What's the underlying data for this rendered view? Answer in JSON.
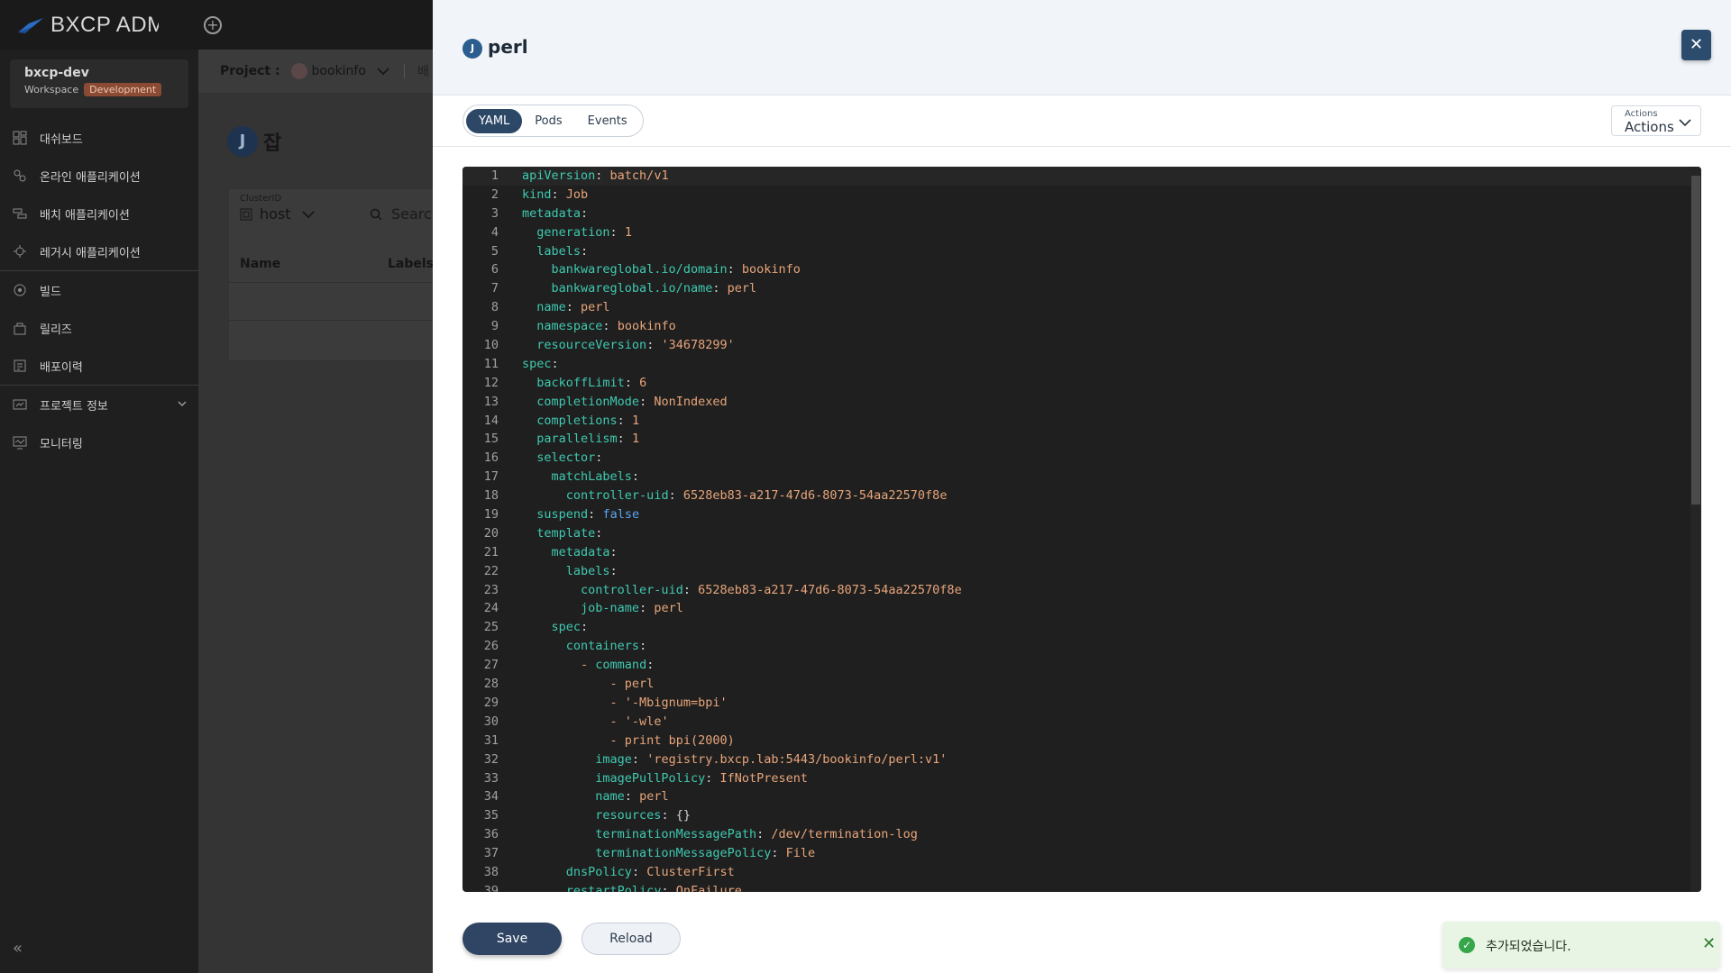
{
  "app": {
    "logo_text": "BXCP ADMIN"
  },
  "workspace": {
    "name": "bxcp-dev",
    "label": "Workspace",
    "badge": "Development"
  },
  "sidebar": {
    "items": [
      {
        "label": "대쉬보드",
        "icon": "dashboard-icon"
      },
      {
        "label": "온라인 애플리케이션",
        "icon": "online-app-icon"
      },
      {
        "label": "배치 애플리케이션",
        "icon": "batch-app-icon"
      },
      {
        "label": "레거시 애플리케이션",
        "icon": "legacy-app-icon"
      },
      {
        "label": "빌드",
        "icon": "build-icon"
      },
      {
        "label": "릴리즈",
        "icon": "release-icon"
      },
      {
        "label": "배포이력",
        "icon": "deploy-history-icon"
      },
      {
        "label": "프로젝트 정보",
        "icon": "project-info-icon"
      },
      {
        "label": "모니터링",
        "icon": "monitoring-icon"
      }
    ],
    "collapse": "«"
  },
  "main": {
    "project_label": "Project :",
    "project_name": "bookinfo",
    "project_extra": "배",
    "page_avatar": "J",
    "page_title": "잡",
    "cluster_label": "ClusterID",
    "cluster_value": "host",
    "search_placeholder": "Search",
    "col_name": "Name",
    "col_labels": "Labels"
  },
  "drawer": {
    "avatar": "J",
    "title": "perl",
    "close": "✕",
    "tabs": [
      {
        "label": "YAML",
        "active": true
      },
      {
        "label": "Pods"
      },
      {
        "label": "Events"
      }
    ],
    "actions_small": "Actions",
    "actions_label": "Actions",
    "save": "Save",
    "reload": "Reload"
  },
  "yaml_lines": [
    [
      [
        0,
        "apiVersion",
        "k"
      ],
      [
        0,
        ": ",
        "p"
      ],
      [
        0,
        "batch/v1",
        "v"
      ]
    ],
    [
      [
        0,
        "kind",
        "k"
      ],
      [
        0,
        ": ",
        "p"
      ],
      [
        0,
        "Job",
        "v"
      ]
    ],
    [
      [
        0,
        "metadata",
        "k"
      ],
      [
        0,
        ":",
        "p"
      ]
    ],
    [
      [
        1,
        "generation",
        "k"
      ],
      [
        0,
        ": ",
        "p"
      ],
      [
        0,
        "1",
        "v"
      ]
    ],
    [
      [
        1,
        "labels",
        "k"
      ],
      [
        0,
        ":",
        "p"
      ]
    ],
    [
      [
        2,
        "bankwareglobal.io/domain",
        "k"
      ],
      [
        0,
        ": ",
        "p"
      ],
      [
        0,
        "bookinfo",
        "v"
      ]
    ],
    [
      [
        2,
        "bankwareglobal.io/name",
        "k"
      ],
      [
        0,
        ": ",
        "p"
      ],
      [
        0,
        "perl",
        "v"
      ]
    ],
    [
      [
        1,
        "name",
        "k"
      ],
      [
        0,
        ": ",
        "p"
      ],
      [
        0,
        "perl",
        "v"
      ]
    ],
    [
      [
        1,
        "namespace",
        "k"
      ],
      [
        0,
        ": ",
        "p"
      ],
      [
        0,
        "bookinfo",
        "v"
      ]
    ],
    [
      [
        1,
        "resourceVersion",
        "k"
      ],
      [
        0,
        ": ",
        "p"
      ],
      [
        0,
        "'34678299'",
        "v"
      ]
    ],
    [
      [
        0,
        "spec",
        "k"
      ],
      [
        0,
        ":",
        "p"
      ]
    ],
    [
      [
        1,
        "backoffLimit",
        "k"
      ],
      [
        0,
        ": ",
        "p"
      ],
      [
        0,
        "6",
        "v"
      ]
    ],
    [
      [
        1,
        "completionMode",
        "k"
      ],
      [
        0,
        ": ",
        "p"
      ],
      [
        0,
        "NonIndexed",
        "v"
      ]
    ],
    [
      [
        1,
        "completions",
        "k"
      ],
      [
        0,
        ": ",
        "p"
      ],
      [
        0,
        "1",
        "v"
      ]
    ],
    [
      [
        1,
        "parallelism",
        "k"
      ],
      [
        0,
        ": ",
        "p"
      ],
      [
        0,
        "1",
        "v"
      ]
    ],
    [
      [
        1,
        "selector",
        "k"
      ],
      [
        0,
        ":",
        "p"
      ]
    ],
    [
      [
        2,
        "matchLabels",
        "k"
      ],
      [
        0,
        ":",
        "p"
      ]
    ],
    [
      [
        3,
        "controller-uid",
        "k"
      ],
      [
        0,
        ": ",
        "p"
      ],
      [
        0,
        "6528eb83-a217-47d6-8073-54aa22570f8e",
        "v"
      ]
    ],
    [
      [
        1,
        "suspend",
        "k"
      ],
      [
        0,
        ": ",
        "p"
      ],
      [
        0,
        "false",
        "b"
      ]
    ],
    [
      [
        1,
        "template",
        "k"
      ],
      [
        0,
        ":",
        "p"
      ]
    ],
    [
      [
        2,
        "metadata",
        "k"
      ],
      [
        0,
        ":",
        "p"
      ]
    ],
    [
      [
        3,
        "labels",
        "k"
      ],
      [
        0,
        ":",
        "p"
      ]
    ],
    [
      [
        4,
        "controller-uid",
        "k"
      ],
      [
        0,
        ": ",
        "p"
      ],
      [
        0,
        "6528eb83-a217-47d6-8073-54aa22570f8e",
        "v"
      ]
    ],
    [
      [
        4,
        "job-name",
        "k"
      ],
      [
        0,
        ": ",
        "p"
      ],
      [
        0,
        "perl",
        "v"
      ]
    ],
    [
      [
        2,
        "spec",
        "k"
      ],
      [
        0,
        ":",
        "p"
      ]
    ],
    [
      [
        3,
        "containers",
        "k"
      ],
      [
        0,
        ":",
        "p"
      ]
    ],
    [
      [
        4,
        "- ",
        "v"
      ],
      [
        0,
        "command",
        "k"
      ],
      [
        0,
        ":",
        "p"
      ]
    ],
    [
      [
        6,
        "- perl",
        "v"
      ]
    ],
    [
      [
        6,
        "- '-Mbignum=bpi'",
        "v"
      ]
    ],
    [
      [
        6,
        "- '-wle'",
        "v"
      ]
    ],
    [
      [
        6,
        "- print bpi(2000)",
        "v"
      ]
    ],
    [
      [
        5,
        "image",
        "k"
      ],
      [
        0,
        ": ",
        "p"
      ],
      [
        0,
        "'registry.bxcp.lab:5443/bookinfo/perl:v1'",
        "v"
      ]
    ],
    [
      [
        5,
        "imagePullPolicy",
        "k"
      ],
      [
        0,
        ": ",
        "p"
      ],
      [
        0,
        "IfNotPresent",
        "v"
      ]
    ],
    [
      [
        5,
        "name",
        "k"
      ],
      [
        0,
        ": ",
        "p"
      ],
      [
        0,
        "perl",
        "v"
      ]
    ],
    [
      [
        5,
        "resources",
        "k"
      ],
      [
        0,
        ": ",
        "p"
      ],
      [
        0,
        "{}",
        "p"
      ]
    ],
    [
      [
        5,
        "terminationMessagePath",
        "k"
      ],
      [
        0,
        ": ",
        "p"
      ],
      [
        0,
        "/dev/termination-log",
        "v"
      ]
    ],
    [
      [
        5,
        "terminationMessagePolicy",
        "k"
      ],
      [
        0,
        ": ",
        "p"
      ],
      [
        0,
        "File",
        "v"
      ]
    ],
    [
      [
        3,
        "dnsPolicy",
        "k"
      ],
      [
        0,
        ": ",
        "p"
      ],
      [
        0,
        "ClusterFirst",
        "v"
      ]
    ],
    [
      [
        3,
        "restartPolicy",
        "k"
      ],
      [
        0,
        ": ",
        "p"
      ],
      [
        0,
        "OnFailure",
        "v"
      ]
    ]
  ],
  "toast": {
    "message": "추가되었습니다.",
    "close": "✕",
    "icon": "✓"
  },
  "colors": {
    "accent": "#2c4866",
    "success": "#35a64a",
    "badge": "#8a4a34"
  }
}
